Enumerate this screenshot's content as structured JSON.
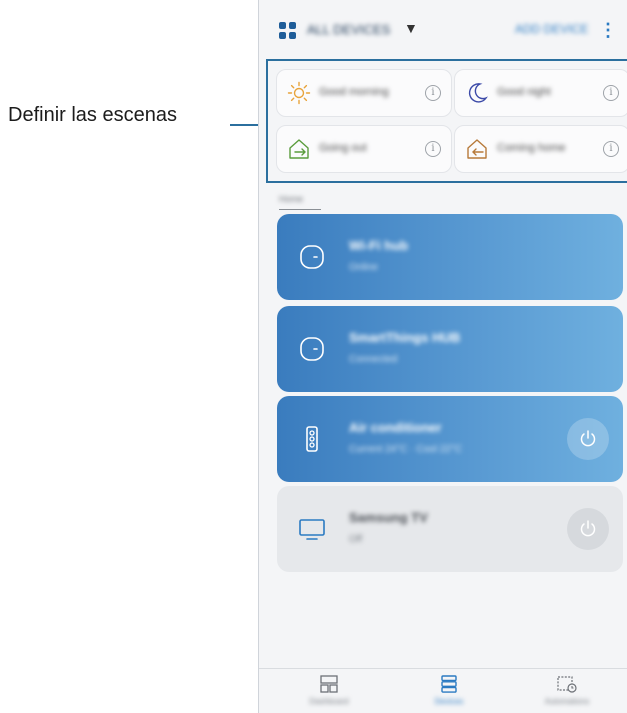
{
  "callout": {
    "label": "Definir las escenas"
  },
  "topbar": {
    "location_name": "ALL DEVICES",
    "caret": "▼",
    "add_device_label": "ADD DEVICE",
    "more": "⋮"
  },
  "scenes": [
    {
      "name": "Good morning",
      "icon": "sun-icon",
      "color": "#e8a33a"
    },
    {
      "name": "Good night",
      "icon": "moon-icon",
      "color": "#3c4aa8"
    },
    {
      "name": "Going out",
      "icon": "leave-home-icon",
      "color": "#5a9c3c"
    },
    {
      "name": "Coming home",
      "icon": "arrive-home-icon",
      "color": "#b77a3a"
    }
  ],
  "scene_info_symbol": "i",
  "devices_section_label": "Home",
  "devices": [
    {
      "name": "Wi-Fi hub",
      "status": "Online",
      "icon": "hub-icon",
      "style": "blue"
    },
    {
      "name": "SmartThings HUB",
      "status": "Connected",
      "icon": "hub-icon",
      "style": "blue"
    },
    {
      "name": "Air conditioner",
      "status": "Current 24°C · Cool 22°C",
      "icon": "air-purifier-icon",
      "style": "blue",
      "power": "power-icon"
    },
    {
      "name": "Samsung TV",
      "status": "Off",
      "icon": "tv-icon",
      "style": "grey",
      "power": "power-icon"
    }
  ],
  "bottom_nav": [
    {
      "label": "Dashboard",
      "icon": "dashboard-icon",
      "active": false
    },
    {
      "label": "Devices",
      "icon": "devices-icon",
      "active": true
    },
    {
      "label": "Automations",
      "icon": "automations-icon",
      "active": false
    }
  ],
  "colors": {
    "accent": "#2a7ac2",
    "callout_line": "#2b6f9e",
    "card_blue": "#4a8dc9"
  }
}
